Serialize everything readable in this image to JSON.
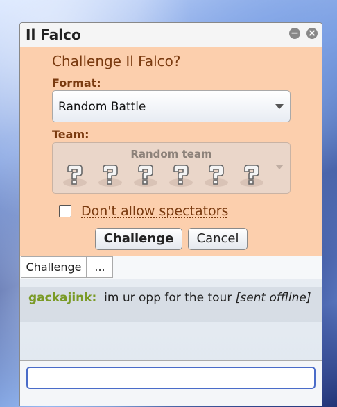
{
  "window": {
    "title": "Il Falco",
    "minimize_icon": "minimize-icon",
    "close_icon": "close-icon"
  },
  "challenge": {
    "heading": "Challenge Il Falco?",
    "format_label": "Format:",
    "format_value": "Random Battle",
    "team_label": "Team:",
    "team_value": "Random team",
    "team_slot_icon": "random-pokemon-icon",
    "team_slot_count": 6,
    "spectators_label": "Don't allow spectators",
    "spectators_checked": false,
    "challenge_button": "Challenge",
    "cancel_button": "Cancel",
    "colors": {
      "panel": "#fccfad",
      "text": "#7a3a0f"
    }
  },
  "tabs": [
    {
      "label": "Challenge"
    },
    {
      "label": "..."
    }
  ],
  "chat": {
    "messages": [
      {
        "sender": "gackajink:",
        "text": "im ur opp for the tour",
        "note": "[sent offline]",
        "sender_color": "#7a9a26"
      }
    ],
    "input_value": ""
  }
}
